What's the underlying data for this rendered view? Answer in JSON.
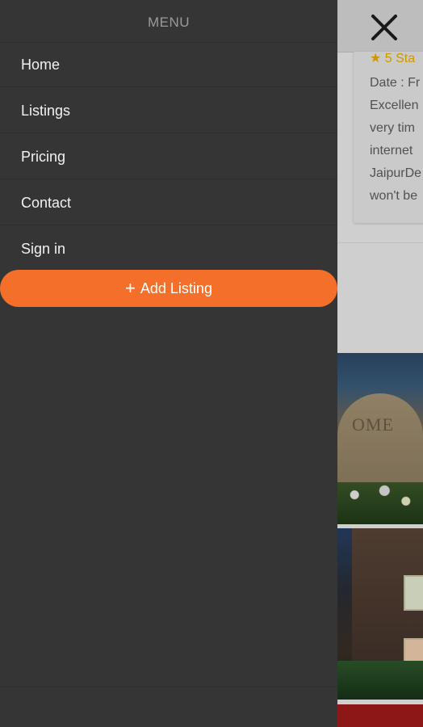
{
  "drawer": {
    "title": "MENU",
    "items": [
      {
        "label": "Home"
      },
      {
        "label": "Listings"
      },
      {
        "label": "Pricing"
      },
      {
        "label": "Contact"
      },
      {
        "label": "Sign in"
      }
    ],
    "add_listing": {
      "label": "Add Listing",
      "icon": "plus-icon",
      "glyph": "+"
    }
  },
  "background": {
    "close_icon": "close-icon",
    "review": {
      "stars_text": "★ 5 Sta",
      "lines": [
        "Date : Fr",
        "Excellen",
        "very tim",
        "internet",
        "JaipurDe",
        "won't be"
      ]
    },
    "photos": {
      "wall_text": "OME"
    }
  },
  "colors": {
    "drawer_bg": "#353535",
    "accent": "#f36f2a",
    "star": "#f2b200"
  }
}
